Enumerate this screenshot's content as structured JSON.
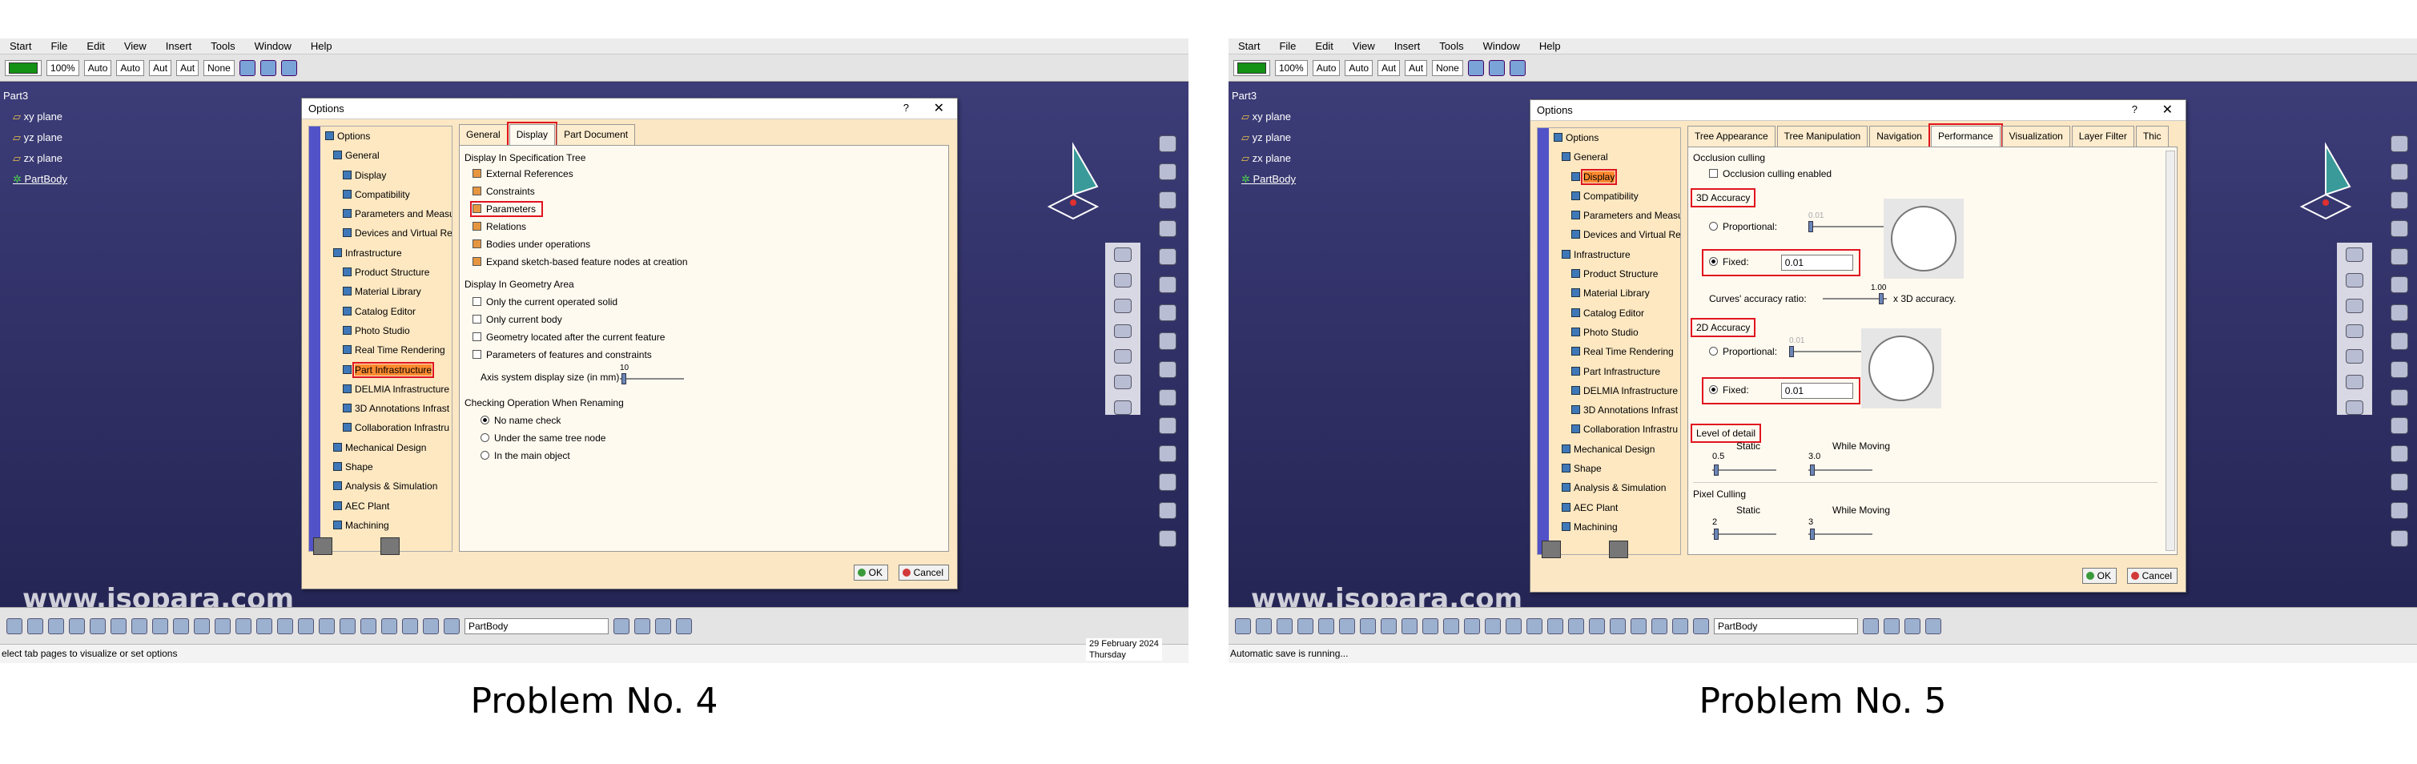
{
  "menu": [
    "Start",
    "File",
    "Edit",
    "View",
    "Insert",
    "Tools",
    "Window",
    "Help"
  ],
  "toolbar": {
    "zoom": "100%",
    "combos": [
      "Auto",
      "Auto",
      "Aut",
      "Aut"
    ],
    "layer": "None"
  },
  "tree_root": "Part3",
  "tree_items": [
    "xy plane",
    "yz plane",
    "zx plane",
    "PartBody"
  ],
  "watermark": "www.isopara.com",
  "partbody_combo": "PartBody",
  "panel1": {
    "caption": "Problem No. 4",
    "status": "elect tab pages to visualize or set options",
    "date": "29 February 2024",
    "day": "Thursday",
    "dialog": {
      "title": "Options",
      "help": "?",
      "close": "✕",
      "tree": [
        "Options",
        "General",
        "Display",
        "Compatibility",
        "Parameters and Measur",
        "Devices and Virtual Rea",
        "Infrastructure",
        "Product Structure",
        "Material Library",
        "Catalog Editor",
        "Photo Studio",
        "Real Time Rendering",
        "Part Infrastructure",
        "DELMIA Infrastructure",
        "3D Annotations Infrast",
        "Collaboration Infrastru",
        "Mechanical Design",
        "Shape",
        "Analysis & Simulation",
        "AEC Plant",
        "Machining"
      ],
      "tabs": [
        "General",
        "Display",
        "Part Document"
      ],
      "section1": "Display In Specification Tree",
      "tree_opts": [
        {
          "label": "External References",
          "checked": true
        },
        {
          "label": "Constraints",
          "checked": true
        },
        {
          "label": "Parameters",
          "checked": true
        },
        {
          "label": "Relations",
          "checked": true
        },
        {
          "label": "Bodies under operations",
          "checked": true
        },
        {
          "label": "Expand sketch-based feature nodes at creation",
          "checked": true
        }
      ],
      "section2": "Display In Geometry Area",
      "geo_opts": [
        {
          "label": "Only the current operated solid",
          "checked": false
        },
        {
          "label": "Only current body",
          "checked": false
        },
        {
          "label": "Geometry located after the current feature",
          "checked": false
        },
        {
          "label": "Parameters of features and constraints",
          "checked": false
        }
      ],
      "axis_label": "Axis system display size (in mm)",
      "axis_value": "10",
      "section3": "Checking Operation When Renaming",
      "rename_opts": [
        {
          "label": "No name check",
          "checked": true
        },
        {
          "label": "Under the same tree node",
          "checked": false
        },
        {
          "label": "In the main object",
          "checked": false
        }
      ],
      "ok": "OK",
      "cancel": "Cancel"
    }
  },
  "panel2": {
    "caption": "Problem No. 5",
    "status": "Automatic save is running...",
    "dialog": {
      "title": "Options",
      "help": "?",
      "close": "✕",
      "tree": [
        "Options",
        "General",
        "Display",
        "Compatibility",
        "Parameters and Measur",
        "Devices and Virtual Rea",
        "Infrastructure",
        "Product Structure",
        "Material Library",
        "Catalog Editor",
        "Photo Studio",
        "Real Time Rendering",
        "Part Infrastructure",
        "DELMIA Infrastructure",
        "3D Annotations Infrast",
        "Collaboration Infrastru",
        "Mechanical Design",
        "Shape",
        "Analysis & Simulation",
        "AEC Plant",
        "Machining"
      ],
      "tabs": [
        "Tree Appearance",
        "Tree Manipulation",
        "Navigation",
        "Performance",
        "Visualization",
        "Layer Filter",
        "Thic"
      ],
      "occlusion_title": "Occlusion culling",
      "occlusion_label": "Occlusion culling enabled",
      "acc3d_title": "3D Accuracy",
      "proportional": "Proportional:",
      "prop3d_value": "0.01",
      "fixed": "Fixed:",
      "fixed3d_value": "0.01",
      "curves_label": "Curves' accuracy ratio:",
      "curves_value": "1.00",
      "curves_suffix": "x 3D accuracy.",
      "acc2d_title": "2D Accuracy",
      "prop2d_value": "0.01",
      "fixed2d_value": "0.01",
      "lod_title": "Level of detail",
      "static": "Static",
      "while_moving": "While Moving",
      "lod_static": "0.5",
      "lod_moving": "3.0",
      "pixel_title": "Pixel Culling",
      "px_static": "2",
      "px_moving": "3",
      "ok": "OK",
      "cancel": "Cancel"
    }
  }
}
